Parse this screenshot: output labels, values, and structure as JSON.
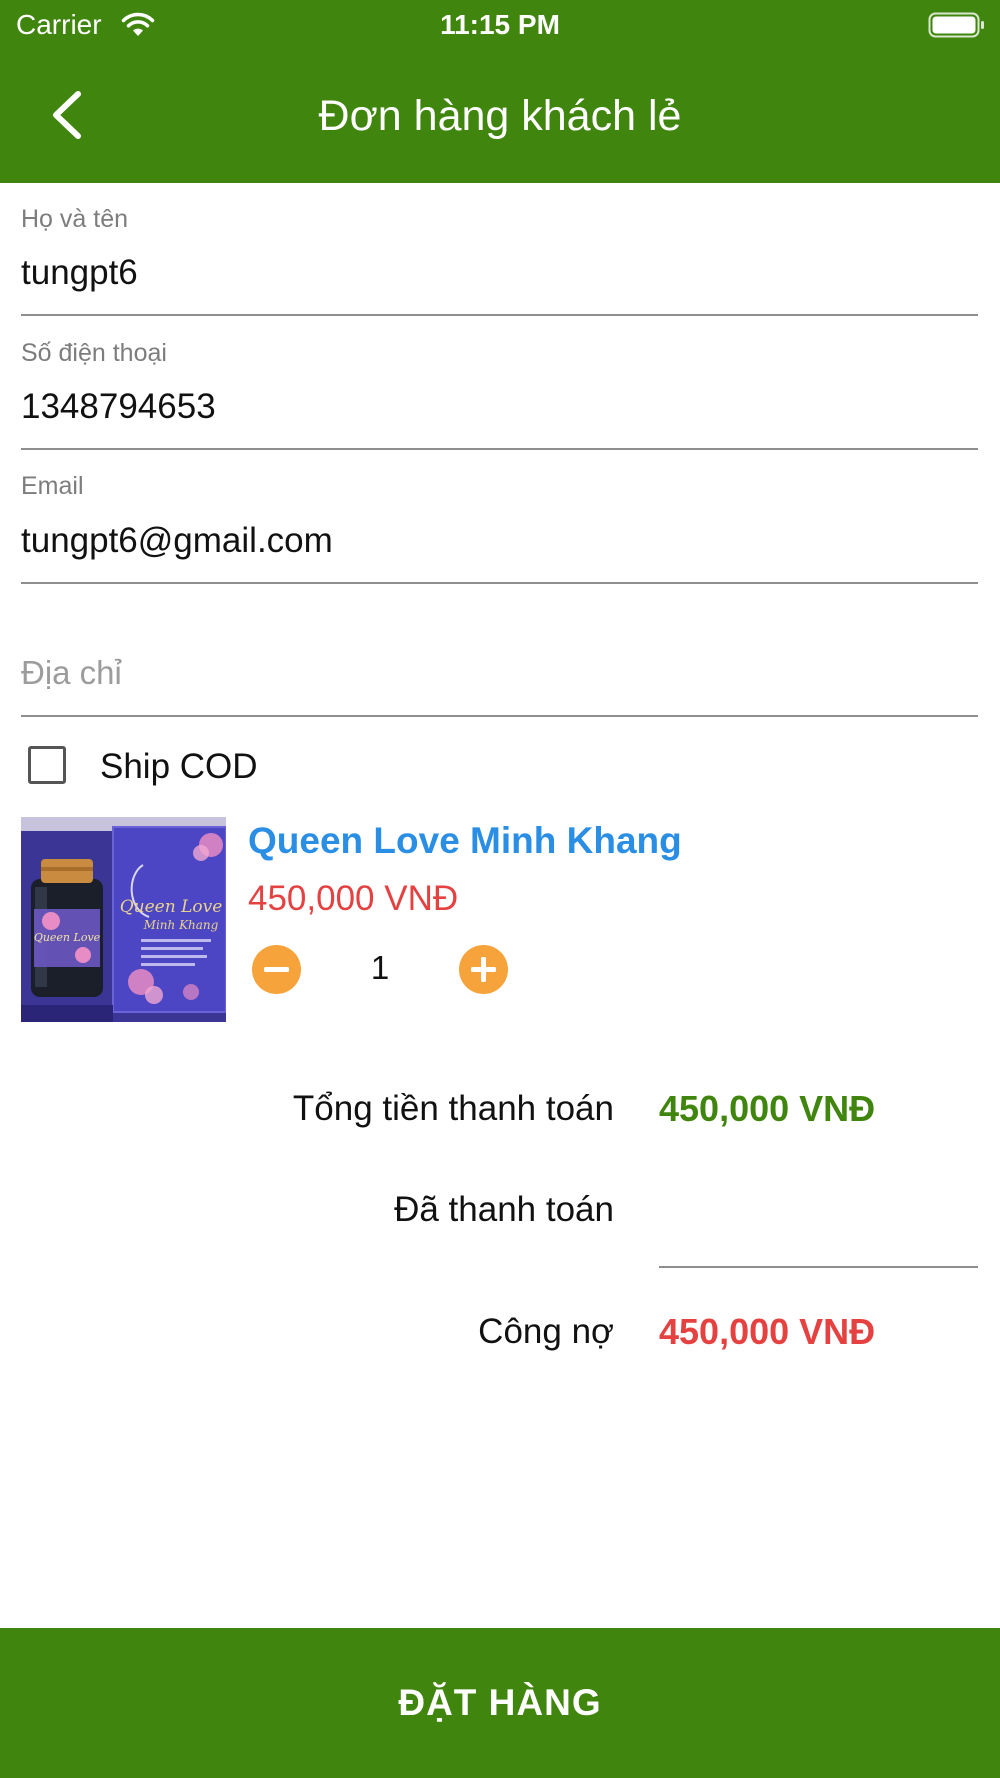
{
  "status_bar": {
    "carrier": "Carrier",
    "time": "11:15 PM",
    "wifi_icon": "wifi-icon",
    "battery_icon": "battery-full-icon"
  },
  "header": {
    "title": "Đơn hàng khách lẻ",
    "back_icon": "chevron-left-icon",
    "background_color": "#40850e"
  },
  "form": {
    "name": {
      "label": "Họ và tên",
      "value": "tungpt6"
    },
    "phone": {
      "label": "Số điện thoại",
      "value": "1348794653"
    },
    "email": {
      "label": "Email",
      "value": "tungpt6@gmail.com"
    },
    "address": {
      "placeholder": "Địa chỉ",
      "value": ""
    },
    "ship_cod": {
      "label": "Ship COD",
      "checked": false
    }
  },
  "product": {
    "name": "Queen Love Minh Khang",
    "price": "450,000 VNĐ",
    "quantity": "1",
    "minus_icon": "minus-circle-icon",
    "plus_icon": "plus-circle-icon",
    "image_text": "Queen Love",
    "image_subtext": "Minh Khang"
  },
  "summary": {
    "total_label": "Tổng tiền thanh toán",
    "total_value": "450,000 VNĐ",
    "paid_label": "Đã thanh toán",
    "paid_value": "",
    "debt_label": "Công nợ",
    "debt_value": "450,000 VNĐ"
  },
  "submit_label": "ĐẶT HÀNG",
  "colors": {
    "primary_green": "#40850e",
    "product_name_blue": "#2a8ee5",
    "price_red": "#e54141",
    "accent_orange": "#f6a33b"
  }
}
